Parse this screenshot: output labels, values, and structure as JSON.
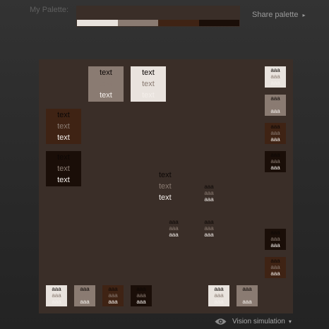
{
  "palette": {
    "label": "My Palette:",
    "colors": [
      "#e9e3de",
      "#8a7b72",
      "#3f2314",
      "#1a0e08"
    ],
    "share_label": "Share palette",
    "share_arrow": "▸"
  },
  "canvas": {
    "background": "#3a2e28",
    "big_swatches": [
      {
        "bg": "#8a7b72",
        "lines": [
          "text",
          "text",
          "text"
        ]
      },
      {
        "bg": "#e9e3de",
        "lines": [
          "text",
          "text",
          "text"
        ]
      },
      {
        "bg": "#3f2314",
        "lines": [
          "text",
          "text",
          "text"
        ]
      },
      {
        "bg": "#1a0e08",
        "lines": [
          "text",
          "text",
          "text"
        ]
      }
    ],
    "small_swatches": [
      {
        "bg": "#e9e3de",
        "lines": [
          "aaa",
          "aaa",
          "aaa"
        ]
      },
      {
        "bg": "#8a7b72",
        "lines": [
          "aaa",
          "aaa",
          "aaa"
        ]
      },
      {
        "bg": "#3f2314",
        "lines": [
          "aaa",
          "aaa",
          "aaa"
        ]
      },
      {
        "bg": "#1a0e08",
        "lines": [
          "aaa",
          "aaa",
          "aaa"
        ]
      },
      {
        "bg": "#1a0e08",
        "lines": [
          "aaa",
          "aaa",
          "aaa"
        ]
      },
      {
        "bg": "#3f2314",
        "lines": [
          "aaa",
          "aaa",
          "aaa"
        ]
      },
      {
        "bg": "#e9e3de",
        "lines": [
          "aaa",
          "aaa",
          "aaa"
        ]
      },
      {
        "bg": "#8a7b72",
        "lines": [
          "aaa",
          "aaa",
          "aaa"
        ]
      },
      {
        "bg": "#3f2314",
        "lines": [
          "aaa",
          "aaa",
          "aaa"
        ]
      },
      {
        "bg": "#1a0e08",
        "lines": [
          "aaa",
          "aaa",
          "aaa"
        ]
      },
      {
        "bg": "#e9e3de",
        "lines": [
          "aaa",
          "aaa",
          "aaa"
        ]
      },
      {
        "bg": "#8a7b72",
        "lines": [
          "aaa",
          "aaa",
          "aaa"
        ]
      }
    ],
    "free_text": [
      "text",
      "text",
      "text"
    ],
    "free_small": [
      [
        "aaa",
        "aaa",
        "aaa"
      ],
      [
        "aaa",
        "aaa",
        "aaa"
      ],
      [
        "aaa",
        "aaa",
        "aaa"
      ]
    ]
  },
  "vision": {
    "label": "Vision simulation",
    "arrow": "▾",
    "icon": "eye-icon"
  }
}
